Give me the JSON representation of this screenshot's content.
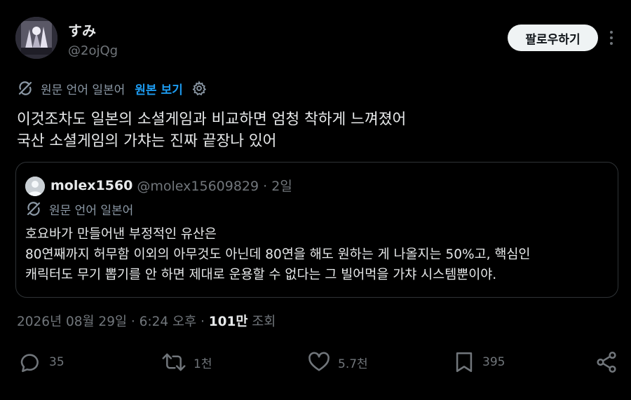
{
  "author": {
    "name": "すみ",
    "handle": "@2ojQg"
  },
  "header": {
    "follow_label": "팔로우하기"
  },
  "translation": {
    "original_language": "원문 언어 일본어",
    "show_original": "원본 보기"
  },
  "tweet": {
    "lines": [
      "이것조차도 일본의 소셜게임과 비교하면 엄청 착하게 느껴졌어",
      "국산 소셜게임의 가챠는 진짜 끝장나 있어"
    ]
  },
  "quote": {
    "name": "molex1560",
    "meta": "@molex15609829 · 2일",
    "original_language": "원문 언어 일본어",
    "lines": [
      "호요바가 만들어낸 부정적인 유산은",
      "80연째까지 허무함 이외의 아무것도 아닌데 80연을 해도 원하는 게 나올지는 50%고, 핵심인",
      "캐릭터도 무기 뽑기를 안 하면 제대로 운용할 수 없다는 그 빌어먹을 가챠 시스템뿐이야."
    ]
  },
  "meta": {
    "timestamp": "2026년 08월 29일 · 6:24 오후 · ",
    "views": "101만",
    "views_label": " 조회"
  },
  "actions": {
    "replies": "35",
    "reposts": "1천",
    "likes": "5.7천",
    "bookmarks": "395"
  },
  "icons": [
    "more-icon",
    "translate-icon",
    "gear-icon",
    "reply-icon",
    "repost-icon",
    "like-icon",
    "bookmark-icon",
    "share-icon"
  ],
  "colors": {
    "background": "#000000",
    "accent": "#1d9bf0",
    "muted": "#71767b",
    "border": "#2f3336"
  }
}
